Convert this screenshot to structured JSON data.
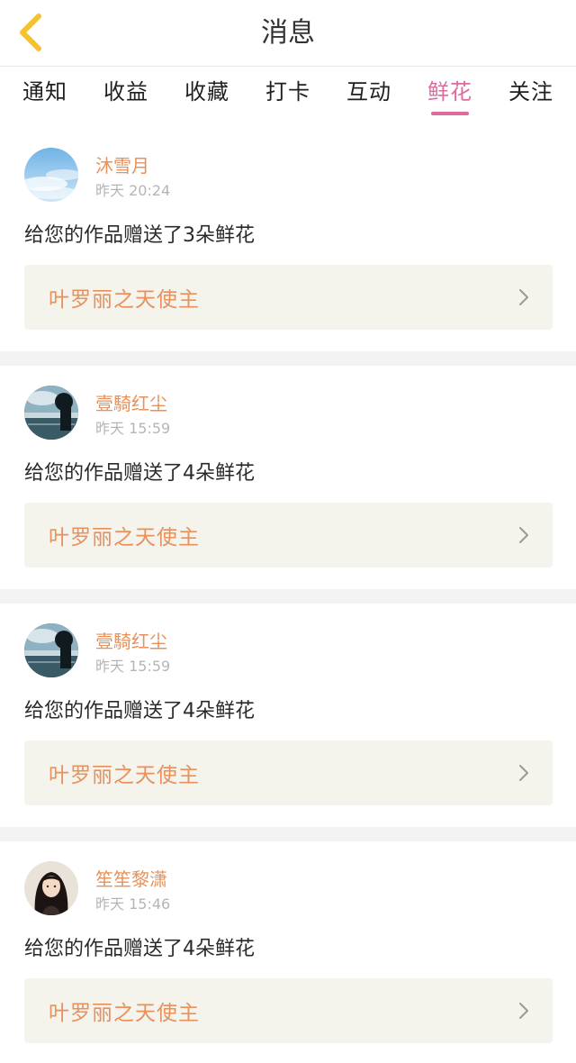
{
  "header": {
    "title": "消息",
    "back_icon": "chevron-left-icon",
    "back_icon_color": "#f5c22b"
  },
  "tabs": [
    {
      "label": "通知",
      "active": false
    },
    {
      "label": "收益",
      "active": false
    },
    {
      "label": "收藏",
      "active": false
    },
    {
      "label": "打卡",
      "active": false
    },
    {
      "label": "互动",
      "active": false
    },
    {
      "label": "鲜花",
      "active": true
    },
    {
      "label": "关注",
      "active": false
    }
  ],
  "colors": {
    "accent_pink": "#e06a9c",
    "name_orange": "#e8915a",
    "link_bg": "#f4f3ec",
    "separator": "#f3f3f3"
  },
  "notifications": [
    {
      "user_name": "沐雪月",
      "timestamp": "昨天 20:24",
      "message": "给您的作品赠送了3朵鲜花",
      "work_title": "叶罗丽之天使主",
      "avatar_icon": "sky-avatar-icon"
    },
    {
      "user_name": "壹騎红尘",
      "timestamp": "昨天 15:59",
      "message": "给您的作品赠送了4朵鲜花",
      "work_title": "叶罗丽之天使主",
      "avatar_icon": "lake-avatar-icon"
    },
    {
      "user_name": "壹騎红尘",
      "timestamp": "昨天 15:59",
      "message": "给您的作品赠送了4朵鲜花",
      "work_title": "叶罗丽之天使主",
      "avatar_icon": "lake-avatar-icon"
    },
    {
      "user_name": "笙笙黎潇",
      "timestamp": "昨天 15:46",
      "message": "给您的作品赠送了4朵鲜花",
      "work_title": "叶罗丽之天使主",
      "avatar_icon": "girl-avatar-icon"
    }
  ]
}
